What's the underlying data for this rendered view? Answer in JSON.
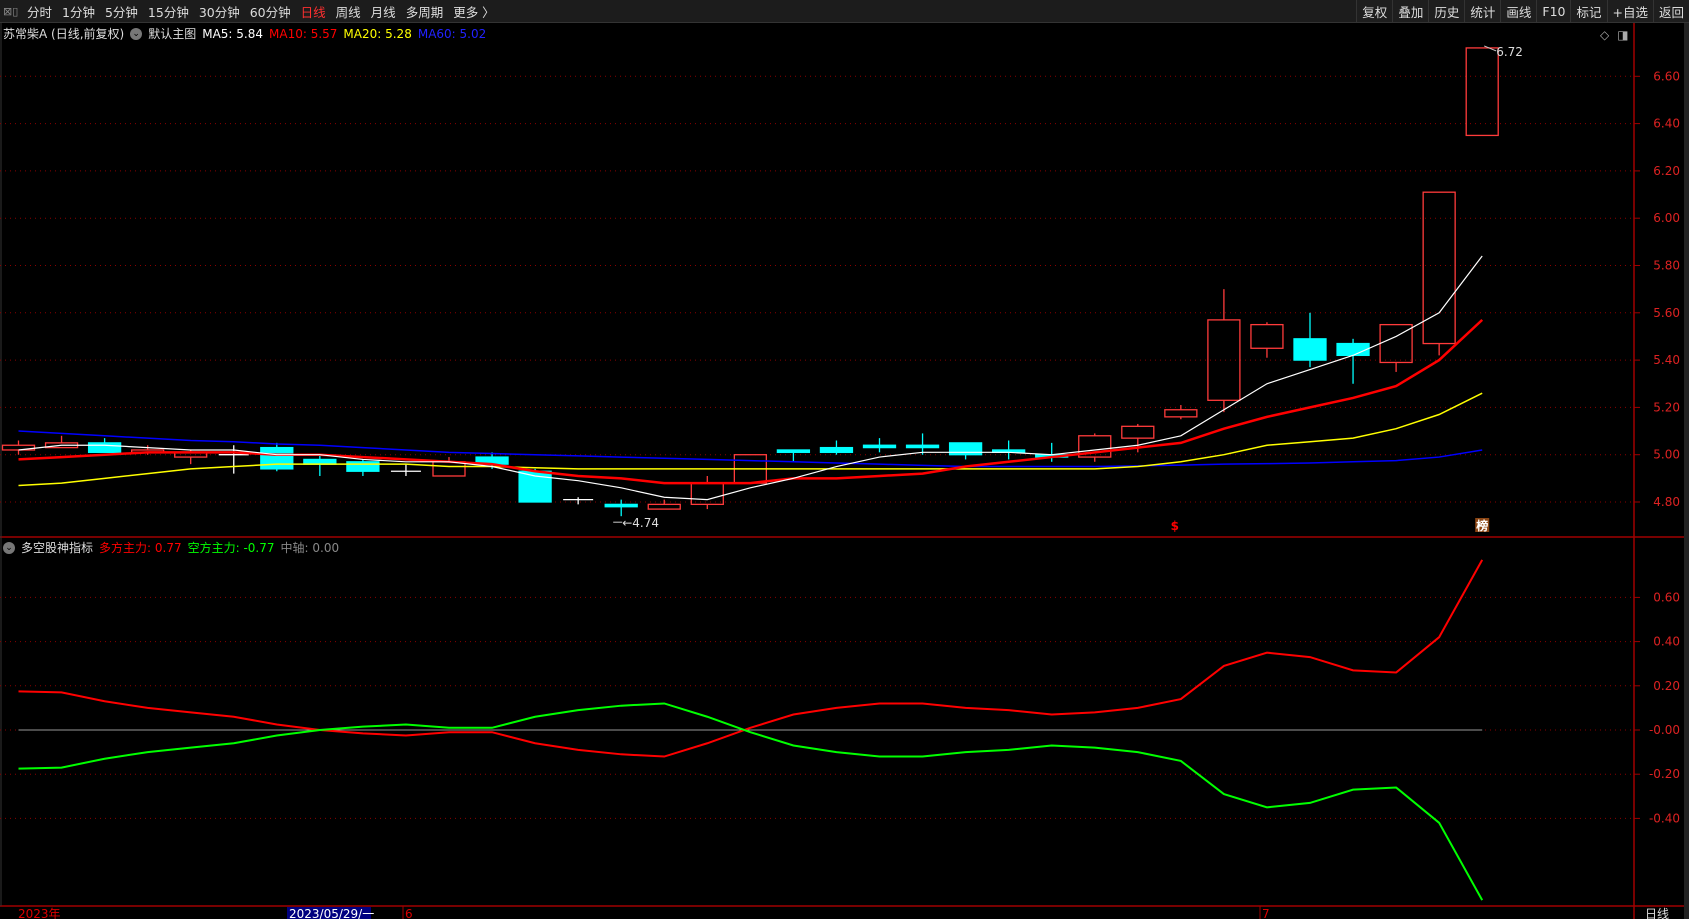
{
  "toolbar": {
    "tabs": [
      "分时",
      "1分钟",
      "5分钟",
      "15分钟",
      "30分钟",
      "60分钟",
      "日线",
      "周线",
      "月线",
      "多周期",
      "更多 〉"
    ],
    "active_tab": "日线",
    "right_buttons": [
      "复权",
      "叠加",
      "历史",
      "统计",
      "画线",
      "F10",
      "标记",
      "+自选",
      "返回"
    ]
  },
  "main_title": {
    "stock": "苏常柴A (日线,前复权)",
    "template": "默认主图",
    "ma5": "MA5: 5.84",
    "ma10": "MA10: 5.57",
    "ma20": "MA20: 5.28",
    "ma60": "MA60: 5.02"
  },
  "indicator_title": {
    "name": "多空股神指标",
    "bull": "多方主力: 0.77",
    "bear": "空方主力: -0.77",
    "axis": "中轴: 0.00"
  },
  "colors": {
    "up": "#ff3b3b",
    "down": "#00ffff",
    "ma5": "#ffffff",
    "ma10": "#ff0000",
    "ma20": "#ffff00",
    "ma60": "#0000ff",
    "grid": "#8b0000",
    "bull": "#ff0000",
    "bear": "#00ff00"
  },
  "chart_data": {
    "type": "candlestick",
    "price_ticks": [
      "6.60",
      "6.40",
      "6.20",
      "6.00",
      "5.80",
      "5.60",
      "5.40",
      "5.20",
      "5.00",
      "4.80"
    ],
    "ohlc": [
      [
        5.02,
        5.06,
        5.0,
        5.04
      ],
      [
        5.03,
        5.08,
        5.03,
        5.05
      ],
      [
        5.05,
        5.07,
        5.01,
        5.01
      ],
      [
        5.01,
        5.04,
        5.0,
        5.02
      ],
      [
        4.99,
        5.02,
        4.96,
        5.01
      ],
      [
        5.0,
        5.04,
        4.92,
        5.0
      ],
      [
        5.03,
        5.05,
        4.93,
        4.94
      ],
      [
        4.98,
        5.0,
        4.91,
        4.96
      ],
      [
        4.97,
        4.98,
        4.91,
        4.93
      ],
      [
        4.93,
        4.96,
        4.91,
        4.93
      ],
      [
        4.91,
        4.99,
        4.91,
        4.97
      ],
      [
        4.99,
        5.01,
        4.94,
        4.96
      ],
      [
        4.93,
        4.94,
        4.8,
        4.8
      ],
      [
        4.81,
        4.82,
        4.79,
        4.81
      ],
      [
        4.79,
        4.81,
        4.74,
        4.78
      ],
      [
        4.77,
        4.81,
        4.77,
        4.79
      ],
      [
        4.79,
        4.91,
        4.77,
        4.88
      ],
      [
        4.88,
        5.0,
        4.88,
        5.0
      ],
      [
        5.02,
        5.02,
        4.97,
        5.01
      ],
      [
        5.03,
        5.06,
        5.0,
        5.01
      ],
      [
        5.04,
        5.07,
        5.01,
        5.03
      ],
      [
        5.04,
        5.09,
        5.0,
        5.03
      ],
      [
        5.05,
        5.05,
        4.98,
        5.0
      ],
      [
        5.02,
        5.06,
        4.98,
        5.01
      ],
      [
        5.0,
        5.05,
        4.97,
        4.99
      ],
      [
        4.99,
        5.09,
        4.97,
        5.08
      ],
      [
        5.07,
        5.13,
        5.01,
        5.12
      ],
      [
        5.16,
        5.21,
        5.15,
        5.19
      ],
      [
        5.23,
        5.7,
        5.18,
        5.57
      ],
      [
        5.45,
        5.56,
        5.41,
        5.55
      ],
      [
        5.49,
        5.6,
        5.37,
        5.4
      ],
      [
        5.47,
        5.49,
        5.3,
        5.42
      ],
      [
        5.39,
        5.55,
        5.35,
        5.55
      ],
      [
        5.47,
        6.11,
        5.42,
        6.11
      ],
      [
        6.35,
        6.72,
        6.35,
        6.72
      ]
    ],
    "ma5": [
      5.02,
      5.04,
      5.04,
      5.03,
      5.02,
      5.02,
      5.0,
      5.0,
      4.98,
      4.97,
      4.97,
      4.95,
      4.91,
      4.89,
      4.86,
      4.82,
      4.81,
      4.86,
      4.9,
      4.95,
      4.99,
      5.01,
      5.01,
      5.01,
      5.0,
      5.02,
      5.04,
      5.08,
      5.19,
      5.3,
      5.36,
      5.42,
      5.5,
      5.6,
      5.84
    ],
    "ma10": [
      4.98,
      4.99,
      5.0,
      5.01,
      5.01,
      5.01,
      5.0,
      5.0,
      4.99,
      4.98,
      4.97,
      4.96,
      4.93,
      4.91,
      4.9,
      4.88,
      4.88,
      4.88,
      4.9,
      4.9,
      4.91,
      4.92,
      4.95,
      4.97,
      4.99,
      5.01,
      5.03,
      5.05,
      5.11,
      5.16,
      5.2,
      5.24,
      5.29,
      5.4,
      5.57
    ],
    "ma20": [
      4.87,
      4.88,
      4.9,
      4.92,
      4.94,
      4.95,
      4.96,
      4.96,
      4.96,
      4.96,
      4.95,
      4.95,
      4.945,
      4.94,
      4.94,
      4.94,
      4.94,
      4.94,
      4.94,
      4.94,
      4.94,
      4.94,
      4.94,
      4.94,
      4.94,
      4.94,
      4.95,
      4.97,
      5.0,
      5.04,
      5.055,
      5.07,
      5.11,
      5.17,
      5.26
    ],
    "ma60": [
      5.1,
      5.09,
      5.08,
      5.07,
      5.06,
      5.055,
      5.045,
      5.04,
      5.03,
      5.02,
      5.01,
      5.005,
      5.0,
      4.995,
      4.99,
      4.985,
      4.98,
      4.975,
      4.97,
      4.965,
      4.96,
      4.955,
      4.95,
      4.95,
      4.95,
      4.95,
      4.953,
      4.956,
      4.96,
      4.962,
      4.965,
      4.97,
      4.975,
      4.99,
      5.02
    ],
    "high_label": "6.72",
    "low_label": "4.74",
    "markers": [
      {
        "index": 27,
        "text": "$"
      },
      {
        "index": 34,
        "text": "榜"
      }
    ],
    "indicator_ticks": [
      "0.60",
      "0.40",
      "0.20",
      "-0.00",
      "-0.20",
      "-0.40"
    ],
    "bull": [
      0.175,
      0.17,
      0.13,
      0.1,
      0.08,
      0.06,
      0.025,
      0,
      -0.015,
      -0.025,
      -0.01,
      -0.01,
      -0.06,
      -0.09,
      -0.11,
      -0.12,
      -0.06,
      0.01,
      0.07,
      0.1,
      0.12,
      0.12,
      0.1,
      0.09,
      0.07,
      0.08,
      0.1,
      0.14,
      0.29,
      0.35,
      0.33,
      0.27,
      0.26,
      0.42,
      0.77
    ],
    "bear": [
      -0.175,
      -0.17,
      -0.13,
      -0.1,
      -0.08,
      -0.06,
      -0.025,
      0,
      0.015,
      0.025,
      0.01,
      0.01,
      0.06,
      0.09,
      0.11,
      0.12,
      0.06,
      -0.01,
      -0.07,
      -0.1,
      -0.12,
      -0.12,
      -0.1,
      -0.09,
      -0.07,
      -0.08,
      -0.1,
      -0.14,
      -0.29,
      -0.35,
      -0.33,
      -0.27,
      -0.26,
      -0.42,
      -0.77
    ],
    "date_labels": {
      "year": "2023年",
      "cursor": "2023/05/29/一",
      "june": "6",
      "july": "7",
      "period": "日线"
    }
  }
}
